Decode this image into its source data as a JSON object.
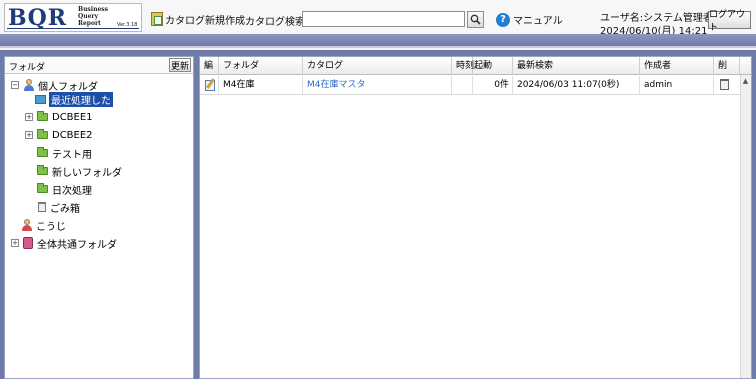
{
  "app": {
    "logo_text": "BQR",
    "logo_sub": [
      "Business",
      "Query",
      "Report"
    ],
    "version": "Ver.3.18"
  },
  "toolbar": {
    "new_catalog_label": "カタログ新規作成",
    "search_label": "カタログ検索",
    "search_value": "",
    "manual_label": "マニュアル",
    "logout_label": "ログアウト"
  },
  "user": {
    "name_line": "ユーザ名:システム管理者",
    "date_line": "2024/06/10(月) 14:21"
  },
  "folder_pane": {
    "title": "フォルダ",
    "refresh_label": "更新",
    "tree": [
      {
        "label": "個人フォルダ",
        "expander": "−",
        "icon": "user-icon",
        "indent": 0
      },
      {
        "label": "最近処理した",
        "icon": "recent-icon",
        "indent": 2,
        "selected": true
      },
      {
        "label": "DCBEE1",
        "expander": "+",
        "icon": "folder-icon",
        "indent": 1
      },
      {
        "label": "DCBEE2",
        "expander": "+",
        "icon": "folder-icon",
        "indent": 1
      },
      {
        "label": "テスト用",
        "icon": "folder-icon",
        "indent": 2
      },
      {
        "label": "新しいフォルダ",
        "icon": "folder-icon",
        "indent": 2
      },
      {
        "label": "日次処理",
        "icon": "folder-icon",
        "indent": 2
      },
      {
        "label": "ごみ箱",
        "icon": "trash-icon",
        "indent": 2
      },
      {
        "label": "こうじ",
        "icon": "users-icon",
        "indent": 0
      },
      {
        "label": "全体共通フォルダ",
        "expander": "+",
        "icon": "shared-folder-icon",
        "indent": 0
      }
    ]
  },
  "catalog_table": {
    "headers": [
      "編",
      "フォルダ",
      "カタログ",
      "時刻起動",
      "",
      "最新検索",
      "作成者",
      "削"
    ],
    "rows": [
      {
        "edit_icon": "edit-icon",
        "folder": "M4在庫",
        "catalog": "M4在庫マスタ",
        "timer": "",
        "count": "0件",
        "last_search": "2024/06/03 11:07(0秒)",
        "author": "admin",
        "delete_icon": "trash-icon"
      }
    ]
  }
}
